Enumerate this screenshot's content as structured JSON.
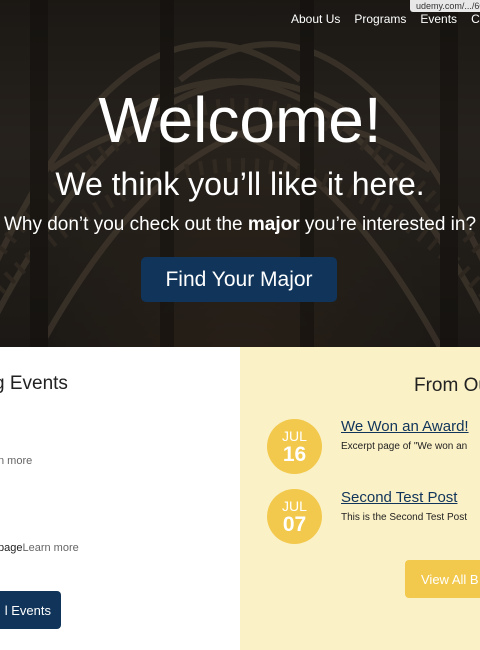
{
  "browser": {
    "status_url": "udemy.com/.../603"
  },
  "nav": {
    "items": [
      "About Us",
      "Programs",
      "Events",
      "Cam"
    ]
  },
  "hero": {
    "title": "Welcome!",
    "subtitle": "We think you’ll like it here.",
    "question_before": "Why don’t you check out the ",
    "question_bold": "major",
    "question_after": " you’re interested in?",
    "cta_label": "Find Your Major"
  },
  "events": {
    "heading": "g Events",
    "item1_link": "n more",
    "item2_text": "page",
    "item2_link": "Learn more",
    "all_button": "l Events"
  },
  "blog": {
    "heading": "From Ou",
    "posts": [
      {
        "month": "JUL",
        "day": "16",
        "title": "We Won an Award!",
        "excerpt": "Excerpt page of \"We won an"
      },
      {
        "month": "JUL",
        "day": "07",
        "title": "Second Test Post",
        "excerpt": "This is the Second Test Post"
      }
    ],
    "view_all": "View All B"
  },
  "colors": {
    "navy": "#10345a",
    "gold": "#f2c94c",
    "cream": "#fbf1c7"
  }
}
